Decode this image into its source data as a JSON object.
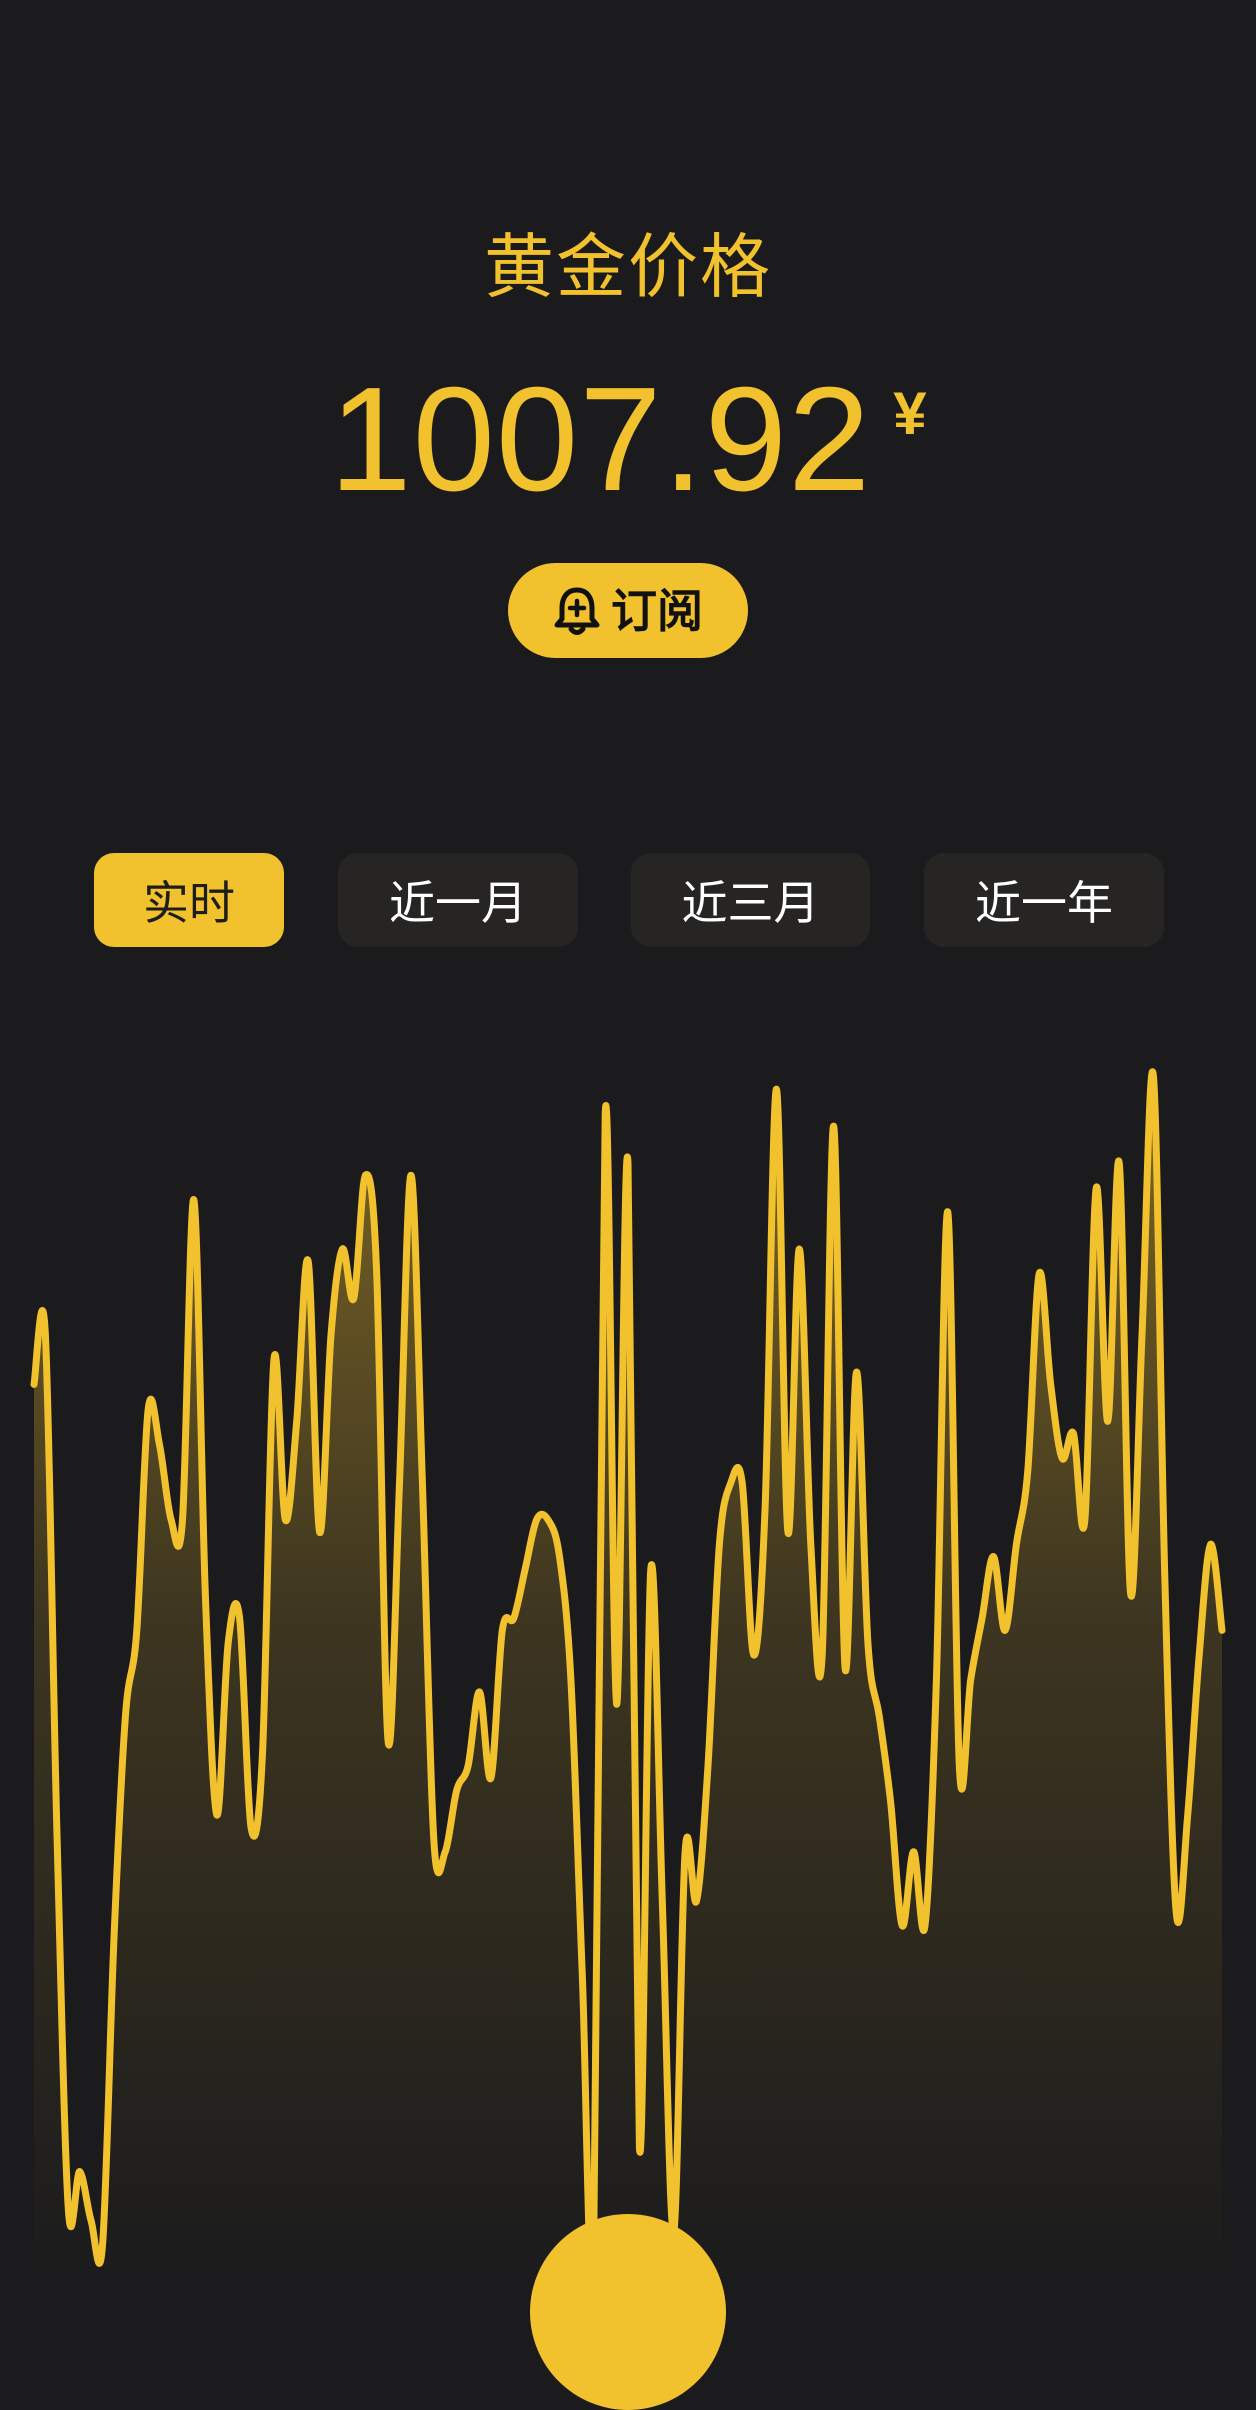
{
  "header": {
    "title": "黄金价格",
    "price": "1007.92",
    "currency": "¥"
  },
  "subscribe": {
    "label": "订阅",
    "icon": "bell-icon"
  },
  "tabs": [
    {
      "label": "实时",
      "active": true
    },
    {
      "label": "近一月",
      "active": false
    },
    {
      "label": "近三月",
      "active": false
    },
    {
      "label": "近一年",
      "active": false
    }
  ],
  "colors": {
    "accent": "#f2c12e",
    "background": "#1b1b1d",
    "tab_background": "#262524"
  },
  "chart_data": {
    "type": "area",
    "title": "",
    "xlabel": "",
    "ylabel": "",
    "ylim": [
      0,
      100
    ],
    "grid": false,
    "legend": "none",
    "series": [
      {
        "values": [
          72,
          76,
          36,
          5,
          8,
          4,
          2,
          27,
          45,
          52,
          70,
          67,
          61,
          61,
          87,
          55,
          37,
          51,
          53,
          36,
          42,
          74,
          61,
          69,
          82,
          60,
          76,
          83,
          79,
          89,
          81,
          43,
          64,
          89,
          64,
          35,
          34,
          39,
          41,
          47,
          40,
          52,
          53,
          57,
          61,
          61,
          58,
          48,
          24,
          2,
          94,
          46,
          90,
          10,
          57,
          30,
          3,
          34,
          30,
          41,
          59,
          64,
          64,
          50,
          62,
          96,
          60,
          83,
          59,
          50,
          93,
          49,
          73,
          51,
          45,
          38,
          28,
          34,
          28,
          48,
          86,
          41,
          48,
          53,
          58,
          52,
          59,
          65,
          81,
          72,
          66,
          68,
          61,
          88,
          69,
          90,
          55,
          76,
          97,
          56,
          29,
          37,
          50,
          59,
          52
        ]
      }
    ]
  }
}
